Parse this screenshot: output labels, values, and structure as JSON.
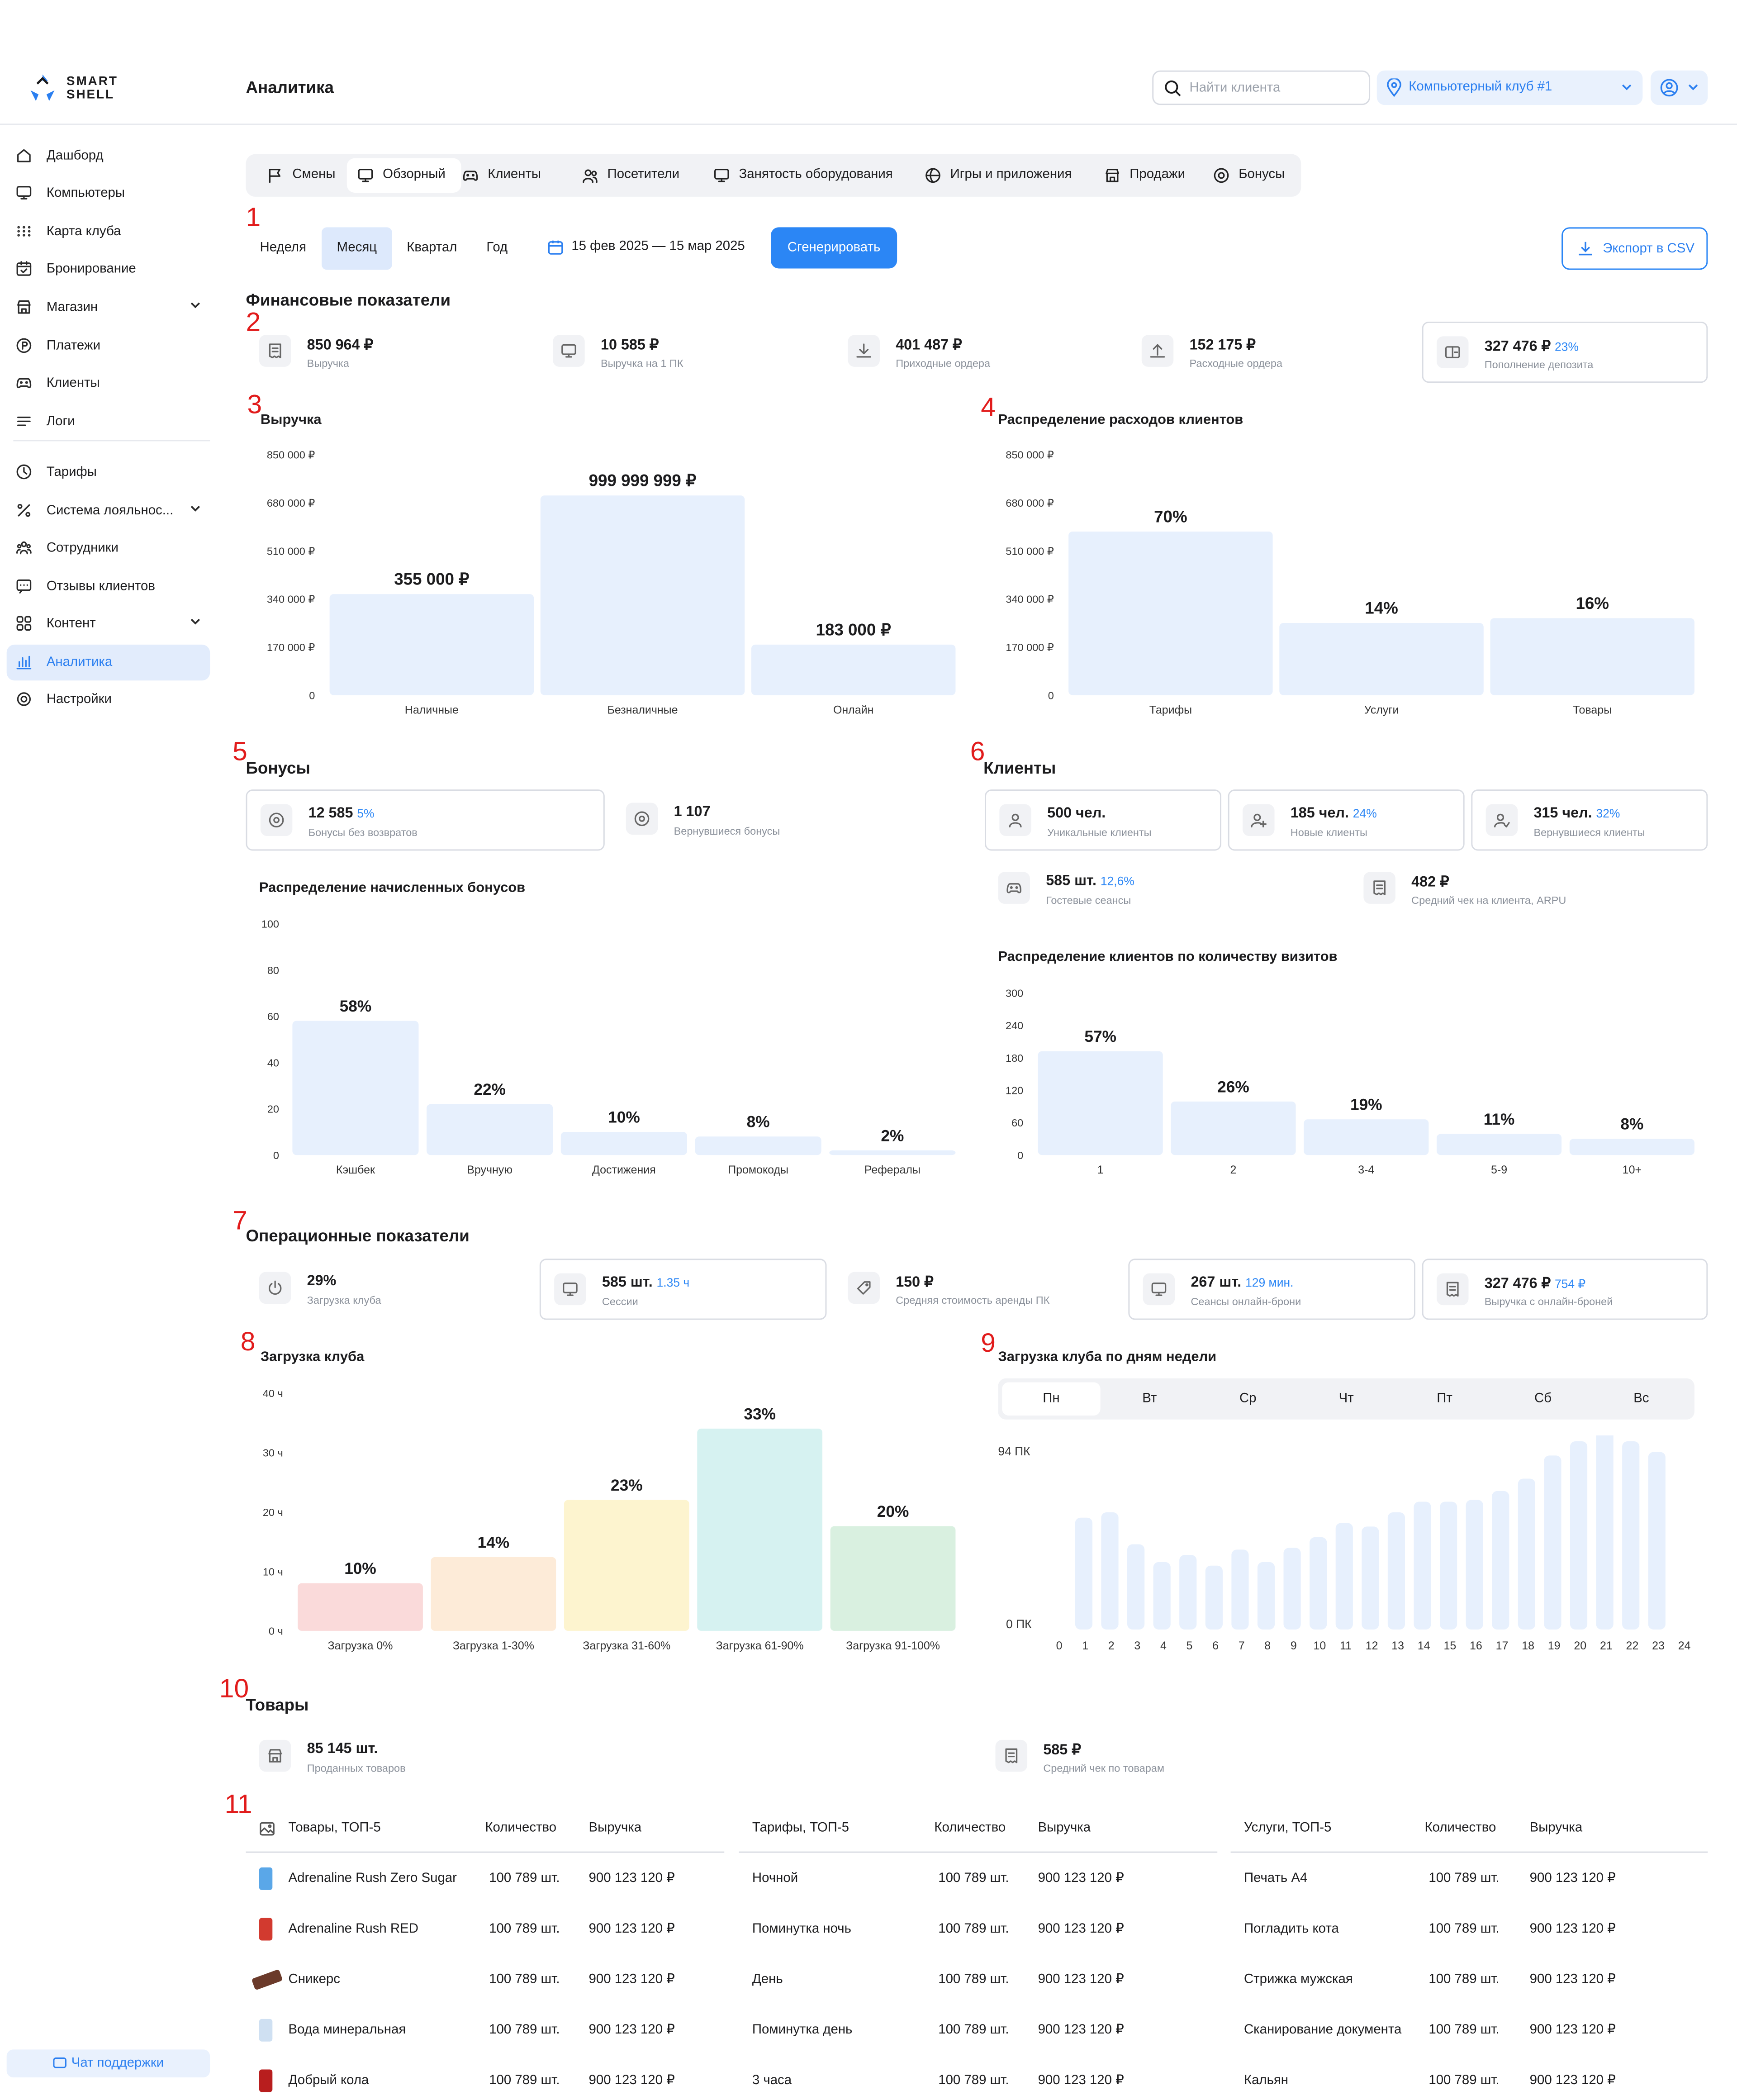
{
  "brand": {
    "line1": "SMART",
    "line2": "SHELL"
  },
  "page_title": "Аналитика",
  "search": {
    "placeholder": "Найти клиента"
  },
  "club_select": {
    "value": "Компьютерный клуб #1"
  },
  "sidebar": {
    "items": [
      {
        "label": "Дашборд",
        "icon": "home-icon"
      },
      {
        "label": "Компьютеры",
        "icon": "monitor-icon"
      },
      {
        "label": "Карта клуба",
        "icon": "grid-dots-icon"
      },
      {
        "label": "Бронирование",
        "icon": "calendar-check-icon"
      },
      {
        "label": "Магазин",
        "icon": "store-icon"
      },
      {
        "label": "Платежи",
        "icon": "payment-icon"
      },
      {
        "label": "Клиенты",
        "icon": "gamepad-icon"
      },
      {
        "label": "Логи",
        "icon": "list-icon"
      },
      {
        "label": "Тарифы",
        "icon": "clock-icon"
      },
      {
        "label": "Система лояльнос...",
        "icon": "percent-icon"
      },
      {
        "label": "Сотрудники",
        "icon": "team-icon"
      },
      {
        "label": "Отзывы клиентов",
        "icon": "chat-icon"
      },
      {
        "label": "Контент",
        "icon": "layout-icon"
      },
      {
        "label": "Аналитика",
        "icon": "chart-icon"
      },
      {
        "label": "Настройки",
        "icon": "gear-icon"
      }
    ],
    "support": "Чат поддержки"
  },
  "tabs": [
    "Смены",
    "Обзорный",
    "Клиенты",
    "Посетители",
    "Занятость оборудования",
    "Игры и приложения",
    "Продажи",
    "Бонусы"
  ],
  "active_tab": "Обзорный",
  "periods": [
    "Неделя",
    "Месяц",
    "Квартал",
    "Год"
  ],
  "active_period": "Месяц",
  "date_range": "15 фев 2025 — 15 мар 2025",
  "generate_label": "Сгенерировать",
  "export_label": "Экспорт в CSV",
  "markers": [
    "1",
    "2",
    "3",
    "4",
    "5",
    "6",
    "7",
    "8",
    "9",
    "10",
    "11"
  ],
  "finance": {
    "title": "Финансовые показатели",
    "cards": [
      {
        "value": "850 964 ₽",
        "label": "Выручка",
        "icon": "receipt-icon"
      },
      {
        "value": "10 585 ₽",
        "label": "Выручка на 1 ПК",
        "icon": "monitor-icon"
      },
      {
        "value": "401 487 ₽",
        "label": "Приходные ордера",
        "icon": "download-icon"
      },
      {
        "value": "152 175 ₽",
        "label": "Расходные ордера",
        "icon": "upload-icon"
      },
      {
        "value": "327 476 ₽",
        "pct": "23%",
        "label": "Пополнение депозита",
        "icon": "wallet-icon"
      }
    ]
  },
  "revenue_chart": {
    "title": "Выручка",
    "chart_data": {
      "type": "bar",
      "categories": [
        "Наличные",
        "Безналичные",
        "Онлайн"
      ],
      "values": [
        355000,
        999999999,
        183000
      ],
      "value_labels": [
        "355 000 ₽",
        "999 999 999 ₽",
        "183 000 ₽"
      ],
      "yticks": [
        "850 000 ₽",
        "680 000 ₽",
        "510 000 ₽",
        "340 000 ₽",
        "170 000 ₽",
        "0"
      ],
      "bar_fraction": [
        0.42,
        0.83,
        0.21
      ]
    }
  },
  "spend_chart": {
    "title": "Распределение расходов клиентов",
    "chart_data": {
      "type": "bar",
      "categories": [
        "Тарифы",
        "Услуги",
        "Товары"
      ],
      "values": [
        70,
        14,
        16
      ],
      "value_labels": [
        "70%",
        "14%",
        "16%"
      ],
      "yticks": [
        "850 000 ₽",
        "680 000 ₽",
        "510 000 ₽",
        "340 000 ₽",
        "170 000 ₽",
        "0"
      ],
      "bar_fraction": [
        0.68,
        0.3,
        0.32
      ]
    }
  },
  "bonuses": {
    "title": "Бонусы",
    "cards": [
      {
        "value": "12 585",
        "pct": "5%",
        "label": "Бонусы без возвратов",
        "icon": "target-icon"
      },
      {
        "value": "1 107",
        "label": "Вернувшиеся бонусы",
        "icon": "target-icon"
      }
    ],
    "chart_title": "Распределение начисленных бонусов",
    "chart_data": {
      "type": "bar",
      "categories": [
        "Кэшбек",
        "Вручную",
        "Достижения",
        "Промокоды",
        "Рефералы"
      ],
      "values": [
        58,
        22,
        10,
        8,
        2
      ],
      "value_labels": [
        "58%",
        "22%",
        "10%",
        "8%",
        "2%"
      ],
      "yticks": [
        "100",
        "80",
        "60",
        "40",
        "20",
        "0"
      ],
      "ylim": [
        0,
        100
      ]
    }
  },
  "clients": {
    "title": "Клиенты",
    "cards": [
      {
        "value": "500 чел.",
        "label": "Уникальные клиенты",
        "icon": "user-icon"
      },
      {
        "value": "185 чел.",
        "pct": "24%",
        "label": "Новые клиенты",
        "icon": "user-plus-icon"
      },
      {
        "value": "315 чел.",
        "pct": "32%",
        "label": "Вернувшиеся клиенты",
        "icon": "user-return-icon"
      }
    ],
    "cards2": [
      {
        "value": "585 шт.",
        "pct": "12,6%",
        "label": "Гостевые сеансы",
        "icon": "gamepad-icon"
      },
      {
        "value": "482 ₽",
        "label": "Средний чек на клиента, ARPU",
        "icon": "receipt-icon"
      }
    ],
    "chart_title": "Распределение клиентов по количеству визитов",
    "chart_data": {
      "type": "bar",
      "categories": [
        "1",
        "2",
        "3-4",
        "5-9",
        "10+"
      ],
      "values": [
        57,
        26,
        19,
        11,
        8
      ],
      "value_labels": [
        "57%",
        "26%",
        "19%",
        "11%",
        "8%"
      ],
      "yticks": [
        "300",
        "240",
        "180",
        "120",
        "60",
        "0"
      ],
      "bar_fraction": [
        0.64,
        0.33,
        0.22,
        0.13,
        0.1
      ]
    }
  },
  "ops": {
    "title": "Операционные показатели",
    "cards": [
      {
        "value": "29%",
        "label": "Загрузка клуба",
        "icon": "power-icon"
      },
      {
        "value": "585 шт.",
        "pct": "1.35 ч",
        "label": "Сессии",
        "icon": "monitor-icon"
      },
      {
        "value": "150 ₽",
        "label": "Средняя стоимость аренды ПК",
        "icon": "tag-icon"
      },
      {
        "value": "267 шт.",
        "pct": "129 мин.",
        "label": "Сеансы онлайн-брони",
        "icon": "monitor-icon"
      },
      {
        "value": "327 476 ₽",
        "pct": "754 ₽",
        "label": "Выручка с онлайн-броней",
        "icon": "receipt-icon"
      }
    ]
  },
  "load_chart": {
    "title": "Загрузка клуба",
    "chart_data": {
      "type": "bar",
      "categories": [
        "Загрузка 0%",
        "Загрузка 1-30%",
        "Загрузка 31-60%",
        "Загрузка 61-90%",
        "Загрузка 91-100%"
      ],
      "values": [
        10,
        14,
        23,
        33,
        20
      ],
      "value_labels": [
        "10%",
        "14%",
        "23%",
        "33%",
        "20%"
      ],
      "yticks": [
        "40 ч",
        "30 ч",
        "20 ч",
        "10 ч",
        "0 ч"
      ],
      "bar_fraction": [
        0.2,
        0.31,
        0.55,
        0.85,
        0.44
      ],
      "colors": [
        "#fadada",
        "#fdebd8",
        "#fdf4cf",
        "#d6f2f1",
        "#d9f0e0"
      ]
    }
  },
  "week_chart": {
    "title": "Загрузка клуба по дням недели",
    "days": [
      "Пн",
      "Вт",
      "Ср",
      "Чт",
      "Пт",
      "Сб",
      "Вс"
    ],
    "active_day": "Пн",
    "chart_data": {
      "type": "bar",
      "categories": [
        "0",
        "1",
        "2",
        "3",
        "4",
        "5",
        "6",
        "7",
        "8",
        "9",
        "10",
        "11",
        "12",
        "13",
        "14",
        "15",
        "16",
        "17",
        "18",
        "19",
        "20",
        "21",
        "22",
        "23",
        "24"
      ],
      "values": [
        63,
        66,
        48,
        38,
        42,
        36,
        45,
        38,
        46,
        52,
        60,
        58,
        66,
        72,
        72,
        73,
        78,
        85,
        98,
        106,
        114,
        106,
        100
      ],
      "yticks": [
        "94 ПК",
        "0 ПК"
      ],
      "ylim": [
        0,
        94
      ]
    }
  },
  "goods": {
    "title": "Товары",
    "cards": [
      {
        "value": "85 145 шт.",
        "label": "Проданных товаров",
        "icon": "store-icon"
      },
      {
        "value": "585 ₽",
        "label": "Средний чек по товарам",
        "icon": "receipt-icon"
      }
    ]
  },
  "tables": [
    {
      "headers": [
        "Товары, ТОП-5",
        "Количество",
        "Выручка"
      ],
      "rows": [
        [
          "Adrenaline Rush Zero Sugar",
          "100 789 шт.",
          "900 123 120 ₽"
        ],
        [
          "Adrenaline Rush RED",
          "100 789 шт.",
          "900 123 120 ₽"
        ],
        [
          "Сникерс",
          "100 789 шт.",
          "900 123 120 ₽"
        ],
        [
          "Вода минеральная",
          "100 789 шт.",
          "900 123 120 ₽"
        ],
        [
          "Добрый кола",
          "100 789 шт.",
          "900 123 120 ₽"
        ]
      ]
    },
    {
      "headers": [
        "Тарифы, ТОП-5",
        "Количество",
        "Выручка"
      ],
      "rows": [
        [
          "Ночной",
          "100 789 шт.",
          "900 123 120 ₽"
        ],
        [
          "Поминутка ночь",
          "100 789 шт.",
          "900 123 120 ₽"
        ],
        [
          "День",
          "100 789 шт.",
          "900 123 120 ₽"
        ],
        [
          "Поминутка день",
          "100 789 шт.",
          "900 123 120 ₽"
        ],
        [
          "3 часа",
          "100 789 шт.",
          "900 123 120 ₽"
        ]
      ]
    },
    {
      "headers": [
        "Услуги, ТОП-5",
        "Количество",
        "Выручка"
      ],
      "rows": [
        [
          "Печать А4",
          "100 789 шт.",
          "900 123 120 ₽"
        ],
        [
          "Погладить кота",
          "100 789 шт.",
          "900 123 120 ₽"
        ],
        [
          "Стрижка мужская",
          "100 789 шт.",
          "900 123 120 ₽"
        ],
        [
          "Сканирование документа",
          "100 789 шт.",
          "900 123 120 ₽"
        ],
        [
          "Кальян",
          "100 789 шт.",
          "900 123 120 ₽"
        ]
      ]
    }
  ],
  "colors": {
    "accent": "#2b86f5",
    "bar": "#e7f0fd",
    "marker": "#e11b1b"
  }
}
